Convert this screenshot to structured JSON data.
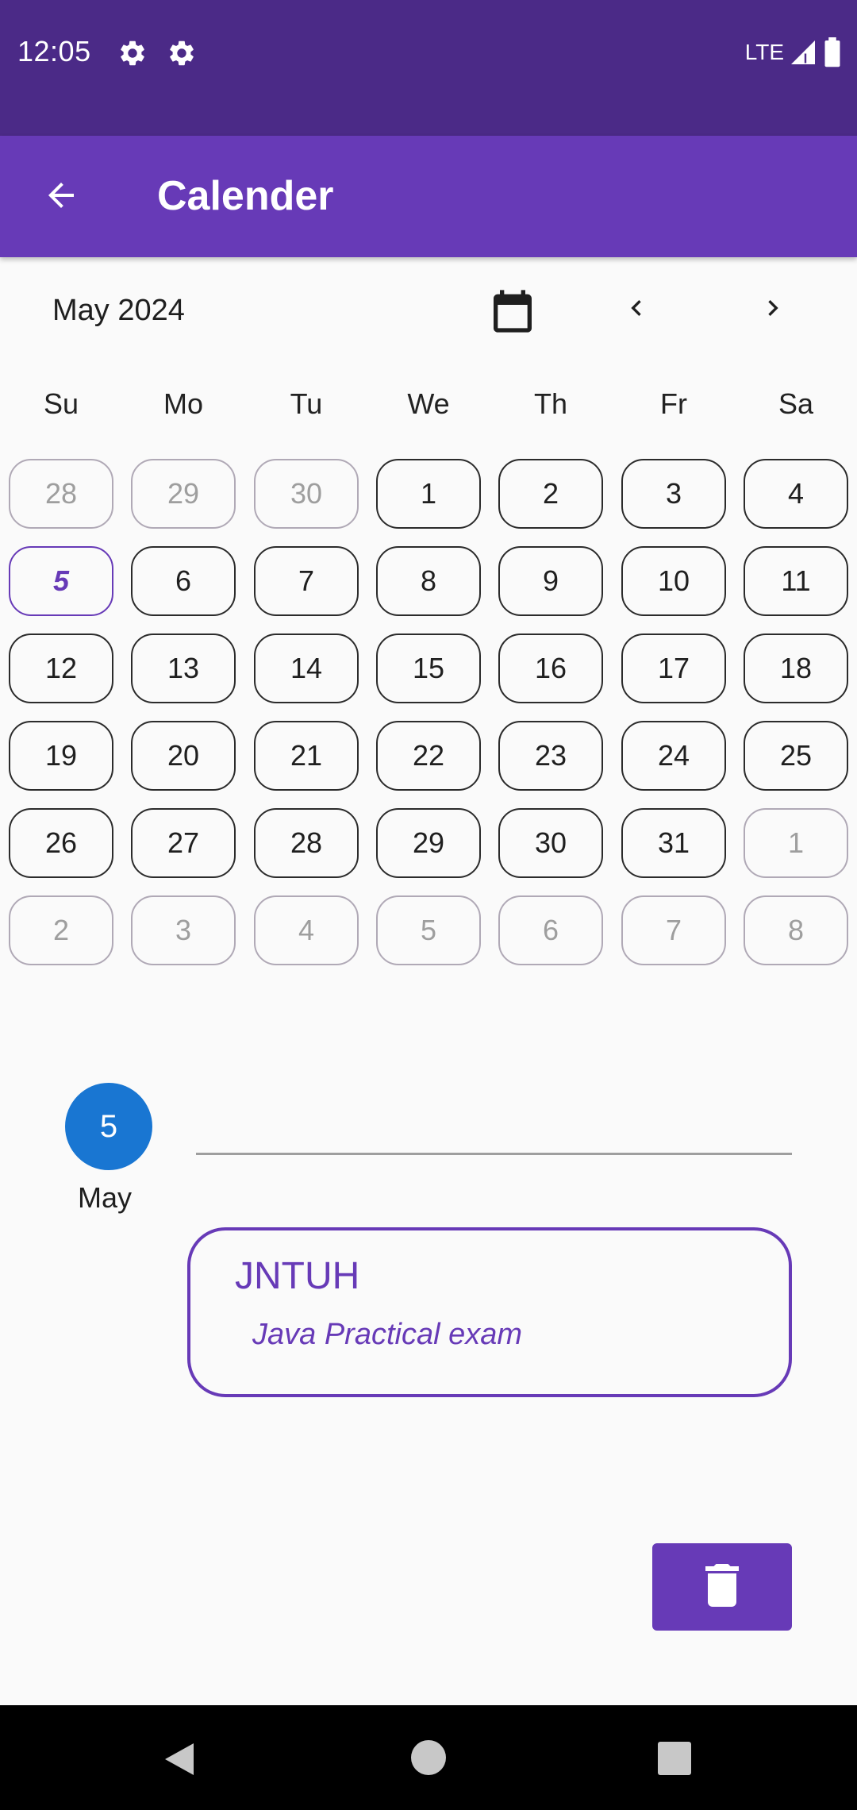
{
  "status_bar": {
    "time": "12:05",
    "network": "LTE",
    "icons": [
      "settings-icon",
      "settings-icon",
      "signal-icon",
      "battery-icon"
    ]
  },
  "app_bar": {
    "title": "Calender",
    "back_icon": "arrow-back-icon"
  },
  "calendar": {
    "month_label": "May 2024",
    "weekdays": [
      "Su",
      "Mo",
      "Tu",
      "We",
      "Th",
      "Fr",
      "Sa"
    ],
    "weeks": [
      [
        {
          "d": "28",
          "other": true
        },
        {
          "d": "29",
          "other": true
        },
        {
          "d": "30",
          "other": true
        },
        {
          "d": "1"
        },
        {
          "d": "2"
        },
        {
          "d": "3"
        },
        {
          "d": "4"
        }
      ],
      [
        {
          "d": "5",
          "selected": true
        },
        {
          "d": "6"
        },
        {
          "d": "7"
        },
        {
          "d": "8"
        },
        {
          "d": "9"
        },
        {
          "d": "10"
        },
        {
          "d": "11"
        }
      ],
      [
        {
          "d": "12"
        },
        {
          "d": "13"
        },
        {
          "d": "14"
        },
        {
          "d": "15"
        },
        {
          "d": "16"
        },
        {
          "d": "17"
        },
        {
          "d": "18"
        }
      ],
      [
        {
          "d": "19"
        },
        {
          "d": "20"
        },
        {
          "d": "21"
        },
        {
          "d": "22"
        },
        {
          "d": "23"
        },
        {
          "d": "24"
        },
        {
          "d": "25"
        }
      ],
      [
        {
          "d": "26"
        },
        {
          "d": "27"
        },
        {
          "d": "28"
        },
        {
          "d": "29"
        },
        {
          "d": "30"
        },
        {
          "d": "31"
        },
        {
          "d": "1",
          "other": true
        }
      ],
      [
        {
          "d": "2",
          "other": true
        },
        {
          "d": "3",
          "other": true
        },
        {
          "d": "4",
          "other": true
        },
        {
          "d": "5",
          "other": true
        },
        {
          "d": "6",
          "other": true
        },
        {
          "d": "7",
          "other": true
        },
        {
          "d": "8",
          "other": true
        }
      ]
    ]
  },
  "event_section": {
    "day_number": "5",
    "month": "May",
    "event": {
      "title": "JNTUH",
      "description": "Java Practical exam"
    },
    "delete_icon": "trash-icon"
  },
  "colors": {
    "status_bar": "#4b2a87",
    "app_bar": "#673ab7",
    "accent": "#673ab7",
    "date_circle": "#1976d2"
  }
}
